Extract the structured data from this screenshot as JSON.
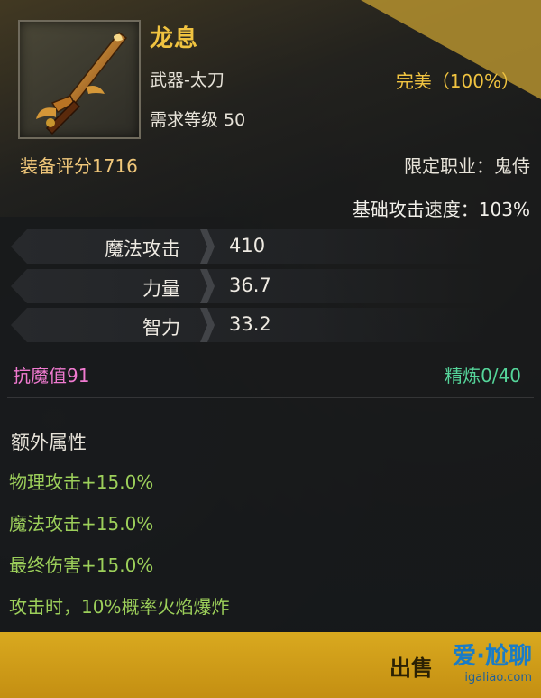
{
  "item": {
    "name": "龙息",
    "type": "武器-太刀",
    "level_req": "需求等级 50",
    "quality": "完美（100%）",
    "score": "装备评分1716",
    "job": "限定职业：鬼侍",
    "attack_speed": "基础攻击速度：103%"
  },
  "attributes": [
    {
      "name": "魔法攻击",
      "value": "410"
    },
    {
      "name": "力量",
      "value": "36.7"
    },
    {
      "name": "智力",
      "value": "33.2"
    }
  ],
  "resist": "抗魔值91",
  "refine": "精炼0/40",
  "extra": {
    "title": "额外属性",
    "lines": [
      "物理攻击+15.0%",
      "魔法攻击+15.0%",
      "最终伤害+15.0%",
      "攻击时，10%概率火焰爆炸"
    ]
  },
  "footer": {
    "sell_label": "出售",
    "watermark_logo": "爱·尬聊",
    "watermark_url": "igaliao.com"
  },
  "colors": {
    "title_gold": "#f0c340",
    "resist_pink": "#f07ad0",
    "refine_green": "#55d59a",
    "extra_green": "#9ccf5a",
    "bar_gold": "#d9a91f"
  },
  "icons": {
    "item_icon": "flame-sword-icon"
  }
}
